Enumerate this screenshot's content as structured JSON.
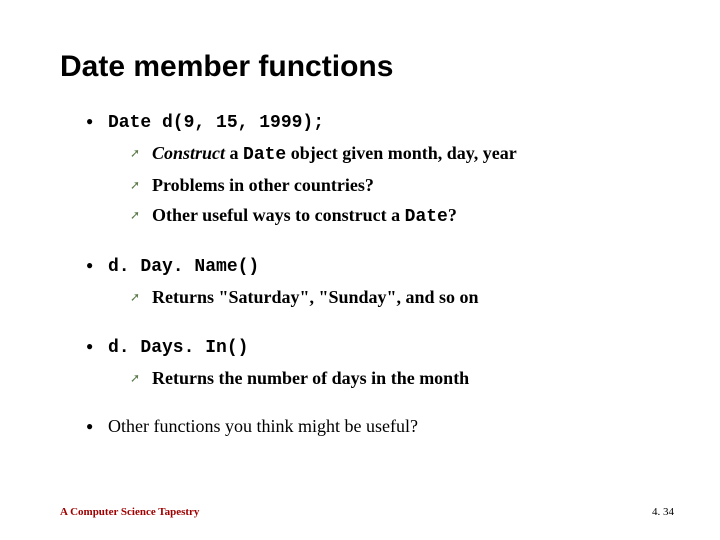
{
  "title": "Date member functions",
  "bullets": [
    {
      "head_code": "Date d(9, 15, 1999);",
      "subs": [
        {
          "parts": [
            {
              "text": "Construct",
              "style": "bold italic"
            },
            {
              "text": " a ",
              "style": "bold"
            },
            {
              "text": "Date",
              "style": "mono"
            },
            {
              "text": " object given month, day, year",
              "style": "bold"
            }
          ]
        },
        {
          "parts": [
            {
              "text": "Problems in other countries?",
              "style": "bold"
            }
          ]
        },
        {
          "parts": [
            {
              "text": "Other useful ways to construct a ",
              "style": "bold"
            },
            {
              "text": "Date",
              "style": "mono"
            },
            {
              "text": "?",
              "style": "bold"
            }
          ]
        }
      ]
    },
    {
      "head_code": "d. Day. Name()",
      "subs": [
        {
          "parts": [
            {
              "text": "Returns \"Saturday\", \"Sunday\", and so on",
              "style": "bold"
            }
          ]
        }
      ]
    },
    {
      "head_code": "d. Days. In()",
      "subs": [
        {
          "parts": [
            {
              "text": "Returns the number of days in the month",
              "style": "bold"
            }
          ]
        }
      ]
    },
    {
      "head_plain": "Other functions you think might be useful?",
      "subs": []
    }
  ],
  "footer": {
    "left": "A Computer Science Tapestry",
    "right": "4. 34"
  }
}
